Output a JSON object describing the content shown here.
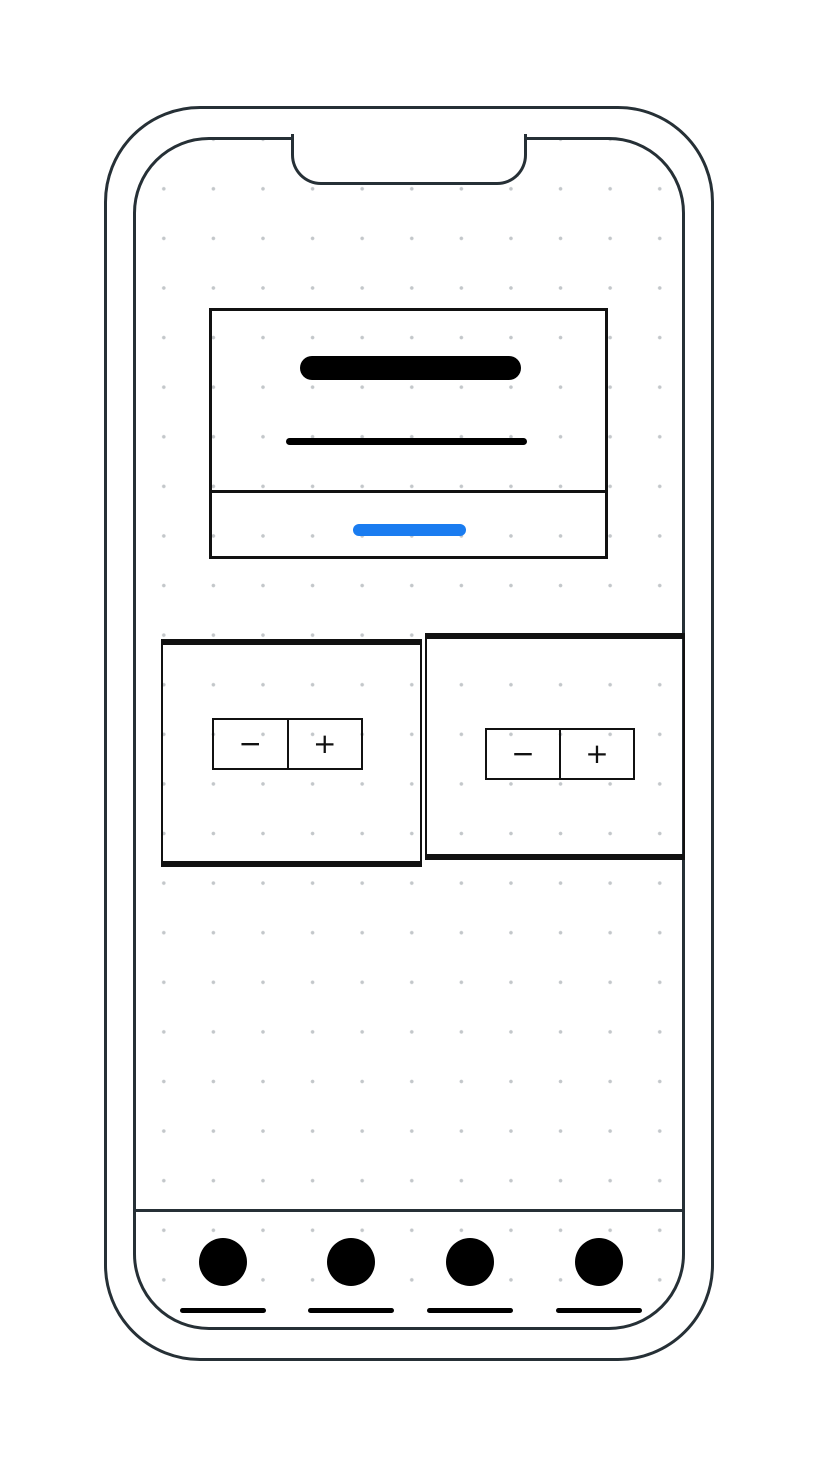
{
  "app": {
    "title": ""
  },
  "dialog": {
    "title": "",
    "message": "",
    "action_label": ""
  },
  "steppers": [
    {
      "decrement_label": "−",
      "increment_label": "+"
    },
    {
      "decrement_label": "−",
      "increment_label": "+"
    }
  ],
  "tabbar": {
    "tabs": [
      {
        "icon": "circle-icon",
        "label": ""
      },
      {
        "icon": "circle-icon",
        "label": ""
      },
      {
        "icon": "circle-icon",
        "label": ""
      },
      {
        "icon": "circle-icon",
        "label": ""
      }
    ]
  },
  "colors": {
    "frame": "#263036",
    "ink": "#111111",
    "accent": "#1a7cf0",
    "grid_dot": "#c3c7ca",
    "background": "#ffffff"
  }
}
